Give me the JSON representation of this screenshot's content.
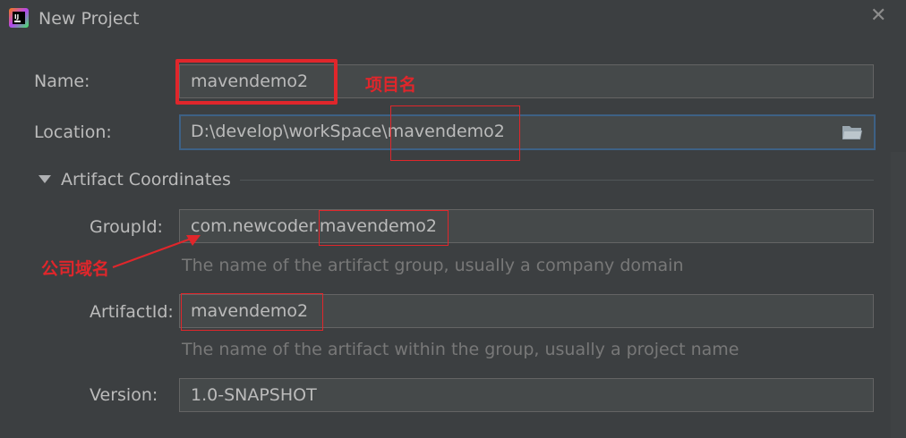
{
  "window": {
    "title": "New Project"
  },
  "form": {
    "name_label": "Name:",
    "name_value": "mavendemo2",
    "location_label": "Location:",
    "location_value": "D:\\develop\\workSpace\\mavendemo2",
    "section_title": "Artifact Coordinates",
    "groupid_label": "GroupId:",
    "groupid_value": "com.newcoder.mavendemo2",
    "groupid_hint": "The name of the artifact group, usually a company domain",
    "artifactid_label": "ArtifactId:",
    "artifactid_value": "mavendemo2",
    "artifactid_hint": "The name of the artifact within the group, usually a project name",
    "version_label": "Version:",
    "version_value": "1.0-SNAPSHOT"
  },
  "annotations": {
    "project_name": "项目名",
    "company_domain": "公司域名"
  },
  "colors": {
    "background": "#3c3f41",
    "field_bg": "#45494a",
    "focus_border": "#3d6185",
    "annotation_red": "#e0262b",
    "hint_text": "#787878"
  },
  "icons": [
    "app-icon",
    "close-icon",
    "triangle-down-icon",
    "folder-icon"
  ]
}
